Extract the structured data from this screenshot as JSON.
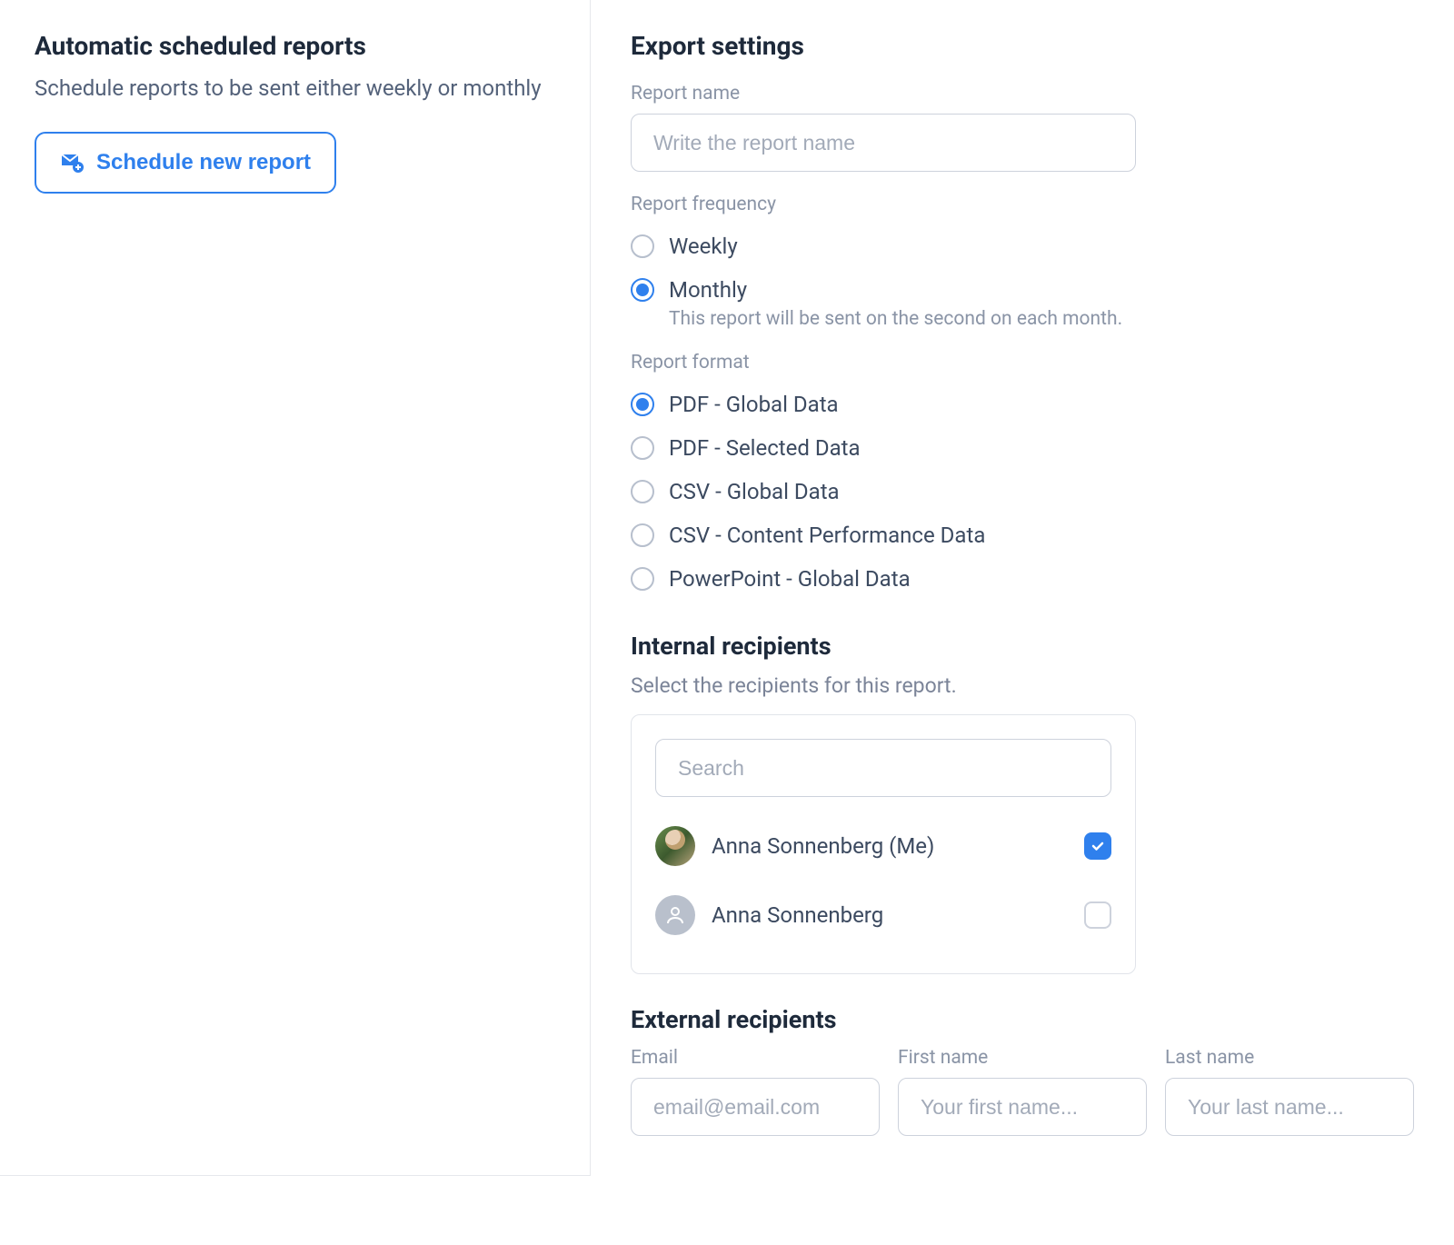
{
  "left": {
    "title": "Automatic scheduled reports",
    "description": "Schedule reports to be sent either weekly or monthly",
    "schedule_button": "Schedule new report"
  },
  "export": {
    "title": "Export settings",
    "report_name_label": "Report name",
    "report_name_placeholder": "Write the report name",
    "report_name_value": "",
    "frequency_label": "Report frequency",
    "frequency_options": [
      {
        "label": "Weekly",
        "selected": false
      },
      {
        "label": "Monthly",
        "selected": true,
        "note": "This report will be sent on the second on each month."
      }
    ],
    "format_label": "Report format",
    "format_options": [
      {
        "label": "PDF - Global Data",
        "selected": true
      },
      {
        "label": "PDF - Selected Data",
        "selected": false
      },
      {
        "label": "CSV - Global Data",
        "selected": false
      },
      {
        "label": "CSV - Content Performance Data",
        "selected": false
      },
      {
        "label": "PowerPoint - Global Data",
        "selected": false
      }
    ]
  },
  "internal": {
    "title": "Internal recipients",
    "description": "Select the recipients for this report.",
    "search_placeholder": "Search",
    "recipients": [
      {
        "name": "Anna Sonnenberg (Me)",
        "checked": true,
        "avatar": "photo"
      },
      {
        "name": "Anna Sonnenberg",
        "checked": false,
        "avatar": "placeholder"
      }
    ]
  },
  "external": {
    "title": "External recipients",
    "email_label": "Email",
    "email_placeholder": "email@email.com",
    "first_name_label": "First name",
    "first_name_placeholder": "Your first name...",
    "last_name_label": "Last name",
    "last_name_placeholder": "Your last name..."
  }
}
